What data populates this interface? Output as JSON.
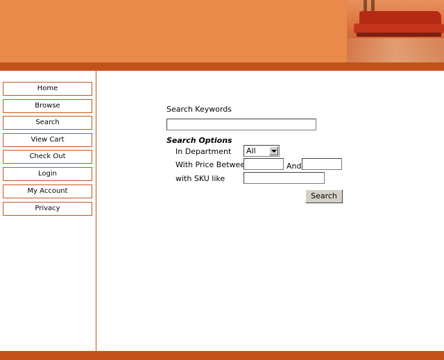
{
  "nav": {
    "items": [
      {
        "label": "Home"
      },
      {
        "label": "Browse"
      },
      {
        "label": "Search"
      },
      {
        "label": "View Cart"
      },
      {
        "label": "Check Out"
      },
      {
        "label": "Login"
      },
      {
        "label": "My Account"
      },
      {
        "label": "Privacy"
      }
    ]
  },
  "search": {
    "keywords_label": "Search Keywords",
    "keywords_value": "",
    "options_title": "Search Options",
    "department_label": "In Department",
    "department_selected": "All",
    "price_label": "With Price Between",
    "price_and_label": "And",
    "price_min": "",
    "price_max": "",
    "sku_label": "with SKU like",
    "sku_value": "",
    "submit_label": "Search"
  },
  "colors": {
    "header": "#e98a4b",
    "accent": "#c4511b"
  }
}
